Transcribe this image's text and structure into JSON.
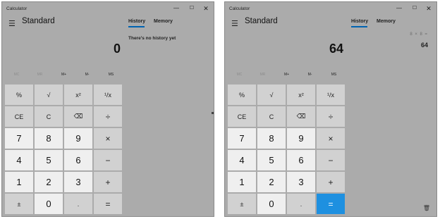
{
  "windows": [
    {
      "id": "before",
      "title": "Calculator",
      "mode": "Standard",
      "tabs": {
        "history": "History",
        "memory": "Memory"
      },
      "display": "0",
      "history_message": "There's no history yet",
      "memory_buttons": [
        {
          "label": "MC",
          "enabled": false
        },
        {
          "label": "MR",
          "enabled": false
        },
        {
          "label": "M+",
          "enabled": true
        },
        {
          "label": "M-",
          "enabled": true
        },
        {
          "label": "MS",
          "enabled": true
        }
      ],
      "keys": [
        [
          "%",
          "√",
          "x²",
          "¹/x"
        ],
        [
          "CE",
          "C",
          "⌫",
          "÷"
        ],
        [
          "7",
          "8",
          "9",
          "×"
        ],
        [
          "4",
          "5",
          "6",
          "−"
        ],
        [
          "1",
          "2",
          "3",
          "+"
        ],
        [
          "±",
          "0",
          ".",
          "="
        ]
      ]
    },
    {
      "id": "after",
      "title": "Calculator",
      "mode": "Standard",
      "tabs": {
        "history": "History",
        "memory": "Memory"
      },
      "display": "64",
      "history_expression": "8 × 8 =",
      "history_result": "64",
      "memory_buttons": [
        {
          "label": "MC",
          "enabled": false
        },
        {
          "label": "MR",
          "enabled": false
        },
        {
          "label": "M+",
          "enabled": true
        },
        {
          "label": "M-",
          "enabled": true
        },
        {
          "label": "MS",
          "enabled": true
        }
      ],
      "keys": [
        [
          "%",
          "√",
          "x²",
          "¹/x"
        ],
        [
          "CE",
          "C",
          "⌫",
          "÷"
        ],
        [
          "7",
          "8",
          "9",
          "×"
        ],
        [
          "4",
          "5",
          "6",
          "−"
        ],
        [
          "1",
          "2",
          "3",
          "+"
        ],
        [
          "±",
          "0",
          ".",
          "="
        ]
      ]
    }
  ],
  "icons": {
    "hamburger": "menu-icon",
    "minimize": "minimize-icon",
    "maximize": "maximize-icon",
    "close": "close-icon",
    "backspace": "backspace-icon",
    "trash": "trash-icon"
  },
  "colors": {
    "window_bg": "#ababab",
    "digit_key": "#efefef",
    "function_key": "#d1d1d1",
    "accent": "#1e90e0",
    "tab_underline": "#0063b1"
  }
}
